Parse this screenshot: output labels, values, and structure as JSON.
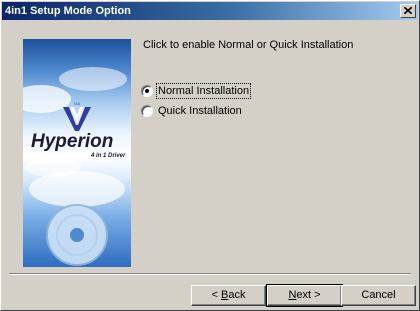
{
  "window": {
    "title": "4in1 Setup Mode Option"
  },
  "banner": {
    "brand": "VIA",
    "product": "Hyperion",
    "tagline": "4 in 1 Driver"
  },
  "prompt": "Click to enable Normal or Quick Installation",
  "options": [
    {
      "label": "Normal Installation",
      "selected": true
    },
    {
      "label": "Quick Installation",
      "selected": false
    }
  ],
  "buttons": {
    "back": {
      "prefix": "< ",
      "accel": "B",
      "rest": "ack"
    },
    "next": {
      "accel": "N",
      "rest": "ext >"
    },
    "cancel": {
      "label": "Cancel"
    }
  }
}
